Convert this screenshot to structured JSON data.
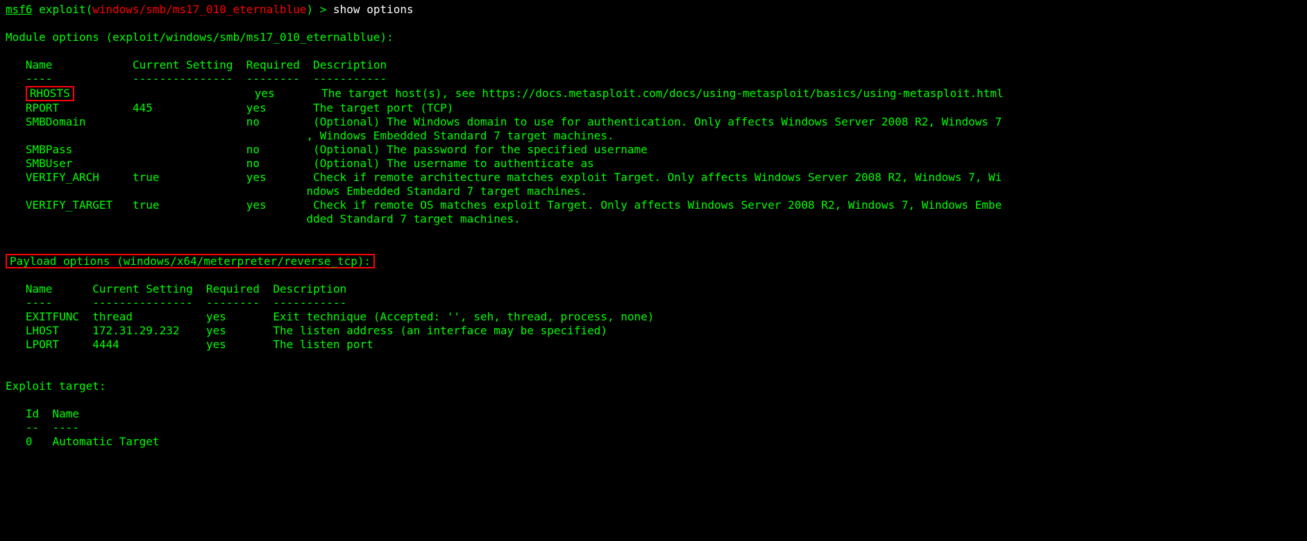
{
  "prompt": {
    "msf": "msf6",
    "exploit_label": "exploit(",
    "module_path": "windows/smb/ms17_010_eternalblue",
    "close_paren": ")",
    "arrow": " > ",
    "command": "show options"
  },
  "module_header": "Module options (exploit/windows/smb/ms17_010_eternalblue):",
  "module_table": {
    "headers": {
      "name": "Name",
      "current": "Current Setting",
      "required": "Required",
      "description": "Description"
    },
    "divider": {
      "name": "----",
      "current": "---------------",
      "required": "--------",
      "description": "-----------"
    },
    "rows": [
      {
        "name": "RHOSTS",
        "current": "",
        "required": "yes",
        "description": "The target host(s), see https://docs.metasploit.com/docs/using-metasploit/basics/using-metasploit.html"
      },
      {
        "name": "RPORT",
        "current": "445",
        "required": "yes",
        "description": "The target port (TCP)"
      },
      {
        "name": "SMBDomain",
        "current": "",
        "required": "no",
        "description": "(Optional) The Windows domain to use for authentication. Only affects Windows Server 2008 R2, Windows 7\n                                             , Windows Embedded Standard 7 target machines."
      },
      {
        "name": "SMBPass",
        "current": "",
        "required": "no",
        "description": "(Optional) The password for the specified username"
      },
      {
        "name": "SMBUser",
        "current": "",
        "required": "no",
        "description": "(Optional) The username to authenticate as"
      },
      {
        "name": "VERIFY_ARCH",
        "current": "true",
        "required": "yes",
        "description": "Check if remote architecture matches exploit Target. Only affects Windows Server 2008 R2, Windows 7, Wi\n                                             ndows Embedded Standard 7 target machines."
      },
      {
        "name": "VERIFY_TARGET",
        "current": "true",
        "required": "yes",
        "description": "Check if remote OS matches exploit Target. Only affects Windows Server 2008 R2, Windows 7, Windows Embe\n                                             dded Standard 7 target machines."
      }
    ]
  },
  "payload_header": "Payload options (windows/x64/meterpreter/reverse_tcp):",
  "payload_table": {
    "headers": {
      "name": "Name",
      "current": "Current Setting",
      "required": "Required",
      "description": "Description"
    },
    "divider": {
      "name": "----",
      "current": "---------------",
      "required": "--------",
      "description": "-----------"
    },
    "rows": [
      {
        "name": "EXITFUNC",
        "current": "thread",
        "required": "yes",
        "description": "Exit technique (Accepted: '', seh, thread, process, none)"
      },
      {
        "name": "LHOST",
        "current": "172.31.29.232",
        "required": "yes",
        "description": "The listen address (an interface may be specified)"
      },
      {
        "name": "LPORT",
        "current": "4444",
        "required": "yes",
        "description": "The listen port"
      }
    ]
  },
  "target_header": "Exploit target:",
  "target_table": {
    "headers": {
      "id": "Id",
      "name": "Name"
    },
    "divider": {
      "id": "--",
      "name": "----"
    },
    "rows": [
      {
        "id": "0",
        "name": "Automatic Target"
      }
    ]
  },
  "highlight": [
    "RHOSTS",
    "payload_header"
  ],
  "cols": {
    "module": {
      "name": 16,
      "current": 17,
      "required": 10
    },
    "payload": {
      "name": 10,
      "current": 17,
      "required": 10
    },
    "target": {
      "id": 4
    }
  }
}
